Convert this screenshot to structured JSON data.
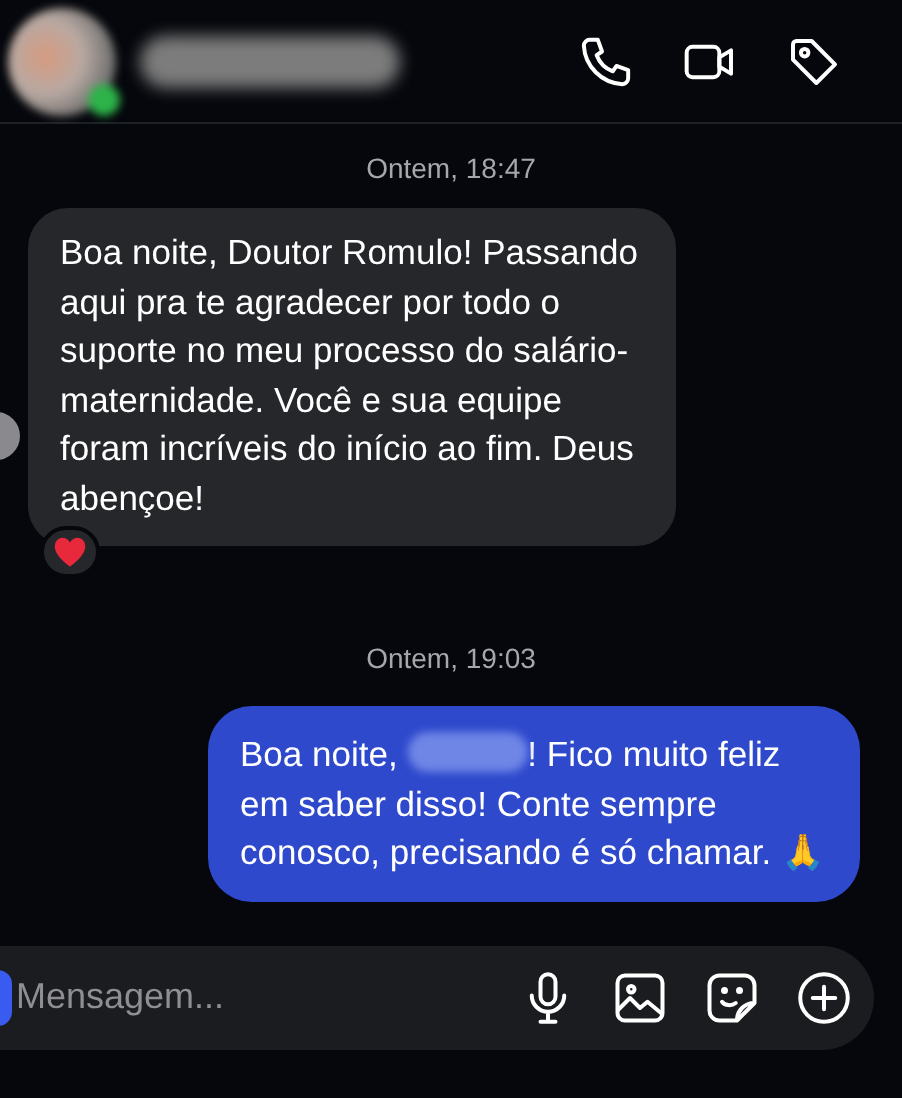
{
  "header": {
    "online": true
  },
  "messages": [
    {
      "kind": "timestamp",
      "text": "Ontem, 18:47"
    },
    {
      "kind": "received",
      "text": "Boa noite, Doutor Romulo! Passando aqui pra te agradecer por todo o suporte no meu processo do salário-maternidade. Você e sua equipe foram incríveis do início ao fim. Deus abençoe!",
      "reaction": true
    },
    {
      "kind": "timestamp",
      "text": "Ontem, 19:03"
    },
    {
      "kind": "sent",
      "text_parts": [
        "Boa noite, ",
        "! Fico muito feliz em saber disso! Conte sempre conosco, precisando é só chamar. 🙏"
      ]
    }
  ],
  "composer": {
    "placeholder": "Mensagem..."
  }
}
